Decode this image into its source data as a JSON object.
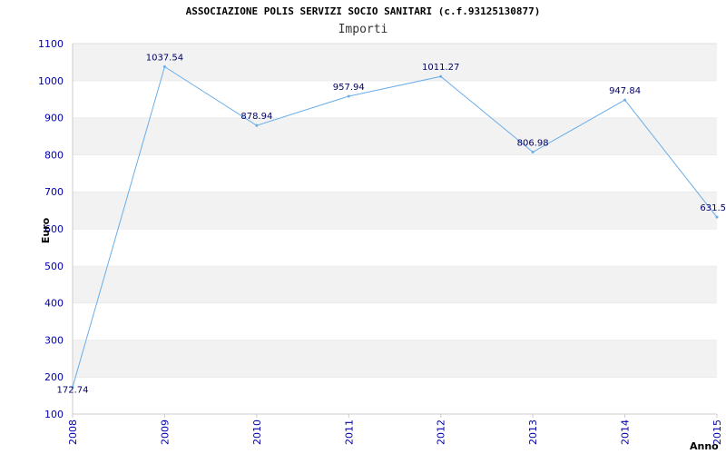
{
  "chart_data": {
    "type": "line",
    "title": "ASSOCIAZIONE POLIS SERVIZI SOCIO SANITARI (c.f.93125130877)",
    "subtitle": "Importi",
    "xlabel": "Anno",
    "ylabel": "Euro",
    "x": [
      "2008",
      "2009",
      "2010",
      "2011",
      "2012",
      "2013",
      "2014",
      "2015"
    ],
    "values": [
      172.74,
      1037.54,
      878.94,
      957.94,
      1011.27,
      806.98,
      947.84,
      631.5
    ],
    "data_labels": [
      "172.74",
      "1037.54",
      "878.94",
      "957.94",
      "1011.27",
      "806.98",
      "947.84",
      "631.5"
    ],
    "ylim": [
      100,
      1100
    ],
    "yticks": [
      100,
      200,
      300,
      400,
      500,
      600,
      700,
      800,
      900,
      1000,
      1100
    ],
    "grid": true,
    "colors": {
      "line": "#6aaee8",
      "band_alt": "#f2f2f2",
      "tick_text": "#0000aa",
      "label_text": "#000066"
    }
  }
}
